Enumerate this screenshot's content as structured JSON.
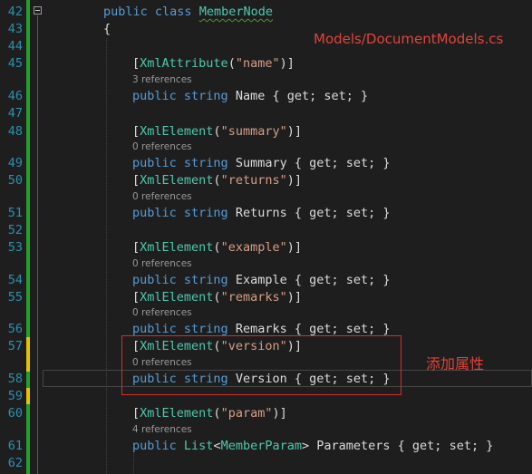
{
  "colors": {
    "background": "#1e1e1e",
    "line_number": "#2b91af",
    "keyword": "#569cd6",
    "type": "#4ec9b0",
    "string": "#d69d85",
    "saved_change": "#1fa12a",
    "unsaved_change": "#e6c300",
    "annotation": "#e0443a"
  },
  "line_numbers": [
    "42",
    "43",
    "44",
    "45",
    "46",
    "47",
    "48",
    "49",
    "50",
    "51",
    "52",
    "53",
    "54",
    "55",
    "56",
    "57",
    "58",
    "59",
    "60",
    "61",
    "62"
  ],
  "class_decl": {
    "kw1": "public",
    "kw2": "class",
    "name": "MemberNode"
  },
  "open_brace": "{",
  "members": [
    {
      "attr": "XmlAttribute",
      "arg": "\"name\"",
      "refs": "3 references",
      "decl_type": "string",
      "decl_name": "Name",
      "accessors": "{ get; set; }"
    },
    {
      "attr": "XmlElement",
      "arg": "\"summary\"",
      "refs": "0 references",
      "decl_type": "string",
      "decl_name": "Summary",
      "accessors": "{ get; set; }"
    },
    {
      "attr": "XmlElement",
      "arg": "\"returns\"",
      "refs": "0 references",
      "decl_type": "string",
      "decl_name": "Returns",
      "accessors": "{ get; set; }"
    },
    {
      "attr": "XmlElement",
      "arg": "\"example\"",
      "refs": "0 references",
      "decl_type": "string",
      "decl_name": "Example",
      "accessors": "{ get; set; }"
    },
    {
      "attr": "XmlElement",
      "arg": "\"remarks\"",
      "refs": "0 references",
      "decl_type": "string",
      "decl_name": "Remarks",
      "accessors": "{ get; set; }"
    },
    {
      "attr": "XmlElement",
      "arg": "\"version\"",
      "refs": "0 references",
      "decl_type": "string",
      "decl_name": "Version",
      "accessors": "{ get; set; }"
    },
    {
      "attr": "XmlElement",
      "arg": "\"param\"",
      "refs": "4 references",
      "decl_type": "List",
      "generic_arg": "MemberParam",
      "decl_name": "Parameters",
      "accessors": "{ get; set; }"
    }
  ],
  "keywords": {
    "public": "public",
    "get": "get",
    "set": "set"
  },
  "annotations": {
    "file_name": "Models/DocumentModels.cs",
    "added_property": "添加属性"
  }
}
